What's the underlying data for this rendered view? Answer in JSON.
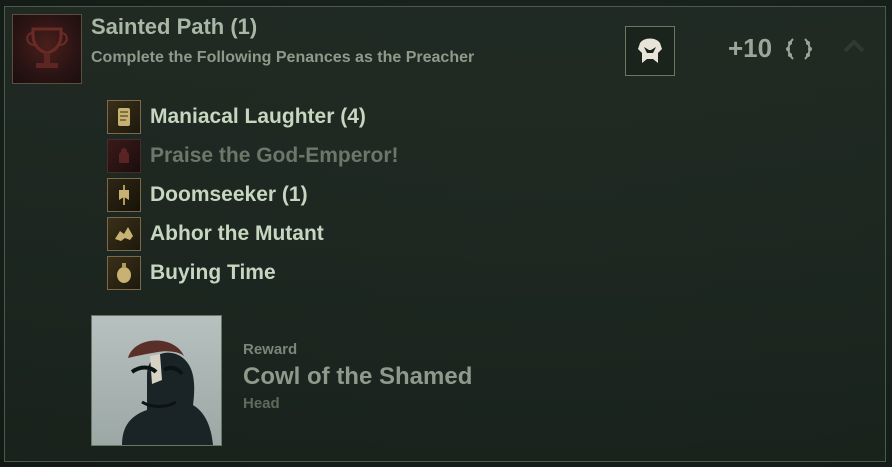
{
  "header": {
    "title": "Sainted Path (1)",
    "subtitle": "Complete the Following Penances as the Preacher",
    "points": "+10",
    "icons": {
      "achievement": "chalice-icon",
      "class": "preacher-helmet-icon",
      "points": "laurel-wreath-icon",
      "collapse": "chevron-up-icon"
    }
  },
  "penances": [
    {
      "label": "Maniacal Laughter (4)",
      "completed": true,
      "icon": "scroll-icon"
    },
    {
      "label": "Praise the God-Emperor!",
      "completed": false,
      "icon": "emperor-icon"
    },
    {
      "label": "Doomseeker (1)",
      "completed": true,
      "icon": "banner-icon"
    },
    {
      "label": "Abhor the Mutant",
      "completed": true,
      "icon": "mutant-icon"
    },
    {
      "label": "Buying Time",
      "completed": true,
      "icon": "grenade-icon"
    }
  ],
  "reward": {
    "label": "Reward",
    "name": "Cowl of the Shamed",
    "slot": "Head",
    "icon": "cowl-portrait"
  },
  "colors": {
    "text_active": "#c6d6c0",
    "text_inactive": "#6c776a",
    "icon_border": "#7a6a4a"
  }
}
